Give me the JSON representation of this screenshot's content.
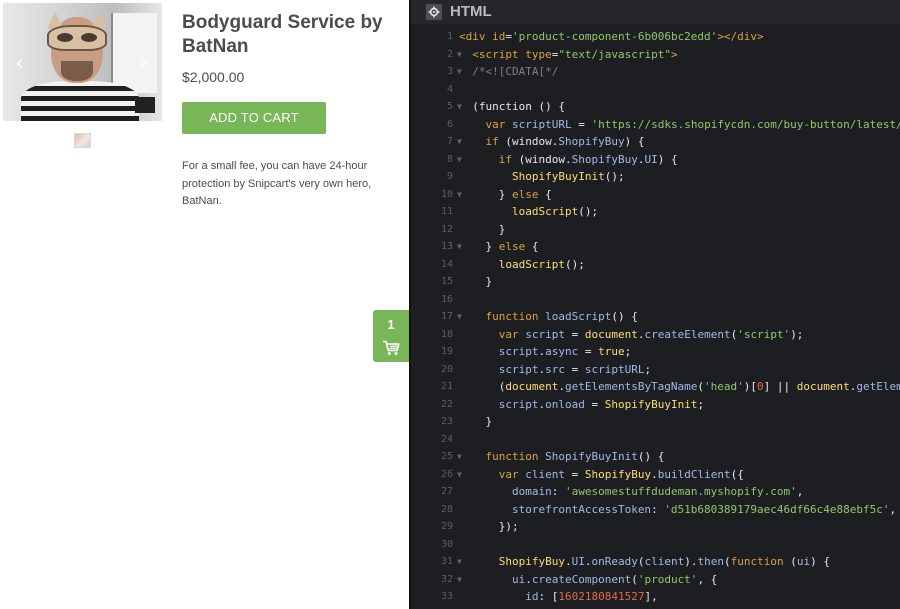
{
  "product": {
    "title": "Bodyguard Service by BatNan",
    "price": "$2,000.00",
    "button_label": "ADD TO CART",
    "description": "For a small fee, you can have 24-hour protection by Snipcart's very own hero, BatNan.",
    "gallery_prev": "‹",
    "gallery_next": "›"
  },
  "cart": {
    "count": "1"
  },
  "editor": {
    "panel_title": "HTML",
    "lines": [
      {
        "n": "1",
        "fold": false,
        "parts": [
          [
            "tag",
            "<div "
          ],
          [
            "attr",
            "id"
          ],
          [
            "plain",
            "="
          ],
          [
            "str",
            "'product-component-6b006bc2edd'"
          ],
          [
            "tag",
            "></div>"
          ]
        ]
      },
      {
        "n": "2",
        "fold": true,
        "parts": [
          [
            "plain",
            "  "
          ],
          [
            "tag",
            "<script "
          ],
          [
            "attr",
            "type"
          ],
          [
            "plain",
            "="
          ],
          [
            "str",
            "\"text/javascript\""
          ],
          [
            "tag",
            ">"
          ]
        ]
      },
      {
        "n": "3",
        "fold": true,
        "parts": [
          [
            "cm",
            "  /*<![CDATA[*/"
          ]
        ]
      },
      {
        "n": "4",
        "fold": false,
        "parts": []
      },
      {
        "n": "5",
        "fold": true,
        "parts": [
          [
            "plain",
            "  (function () {"
          ]
        ]
      },
      {
        "n": "6",
        "fold": false,
        "parts": [
          [
            "plain",
            "    "
          ],
          [
            "kw",
            "var "
          ],
          [
            "prop",
            "scriptURL"
          ],
          [
            "plain",
            " = "
          ],
          [
            "str",
            "'https://sdks.shopifycdn.com/buy-button/latest/"
          ]
        ]
      },
      {
        "n": "7",
        "fold": true,
        "parts": [
          [
            "plain",
            "    "
          ],
          [
            "kw",
            "if "
          ],
          [
            "plain",
            "(window."
          ],
          [
            "prop",
            "ShopifyBuy"
          ],
          [
            "plain",
            ") {"
          ]
        ]
      },
      {
        "n": "8",
        "fold": true,
        "parts": [
          [
            "plain",
            "      "
          ],
          [
            "kw",
            "if "
          ],
          [
            "plain",
            "(window."
          ],
          [
            "prop",
            "ShopifyBuy"
          ],
          [
            "plain",
            "."
          ],
          [
            "prop",
            "UI"
          ],
          [
            "plain",
            ") {"
          ]
        ]
      },
      {
        "n": "9",
        "fold": false,
        "parts": [
          [
            "plain",
            "        "
          ],
          [
            "obj",
            "ShopifyBuyInit"
          ],
          [
            "plain",
            "();"
          ]
        ]
      },
      {
        "n": "10",
        "fold": true,
        "parts": [
          [
            "plain",
            "      } "
          ],
          [
            "kw",
            "else "
          ],
          [
            "plain",
            "{"
          ]
        ]
      },
      {
        "n": "11",
        "fold": false,
        "parts": [
          [
            "plain",
            "        "
          ],
          [
            "obj",
            "loadScript"
          ],
          [
            "plain",
            "();"
          ]
        ]
      },
      {
        "n": "12",
        "fold": false,
        "parts": [
          [
            "plain",
            "      }"
          ]
        ]
      },
      {
        "n": "13",
        "fold": true,
        "parts": [
          [
            "plain",
            "    } "
          ],
          [
            "kw",
            "else "
          ],
          [
            "plain",
            "{"
          ]
        ]
      },
      {
        "n": "14",
        "fold": false,
        "parts": [
          [
            "plain",
            "      "
          ],
          [
            "obj",
            "loadScript"
          ],
          [
            "plain",
            "();"
          ]
        ]
      },
      {
        "n": "15",
        "fold": false,
        "parts": [
          [
            "plain",
            "    }"
          ]
        ]
      },
      {
        "n": "16",
        "fold": false,
        "parts": []
      },
      {
        "n": "17",
        "fold": true,
        "parts": [
          [
            "plain",
            "    "
          ],
          [
            "kw",
            "function "
          ],
          [
            "fnname",
            "loadScript"
          ],
          [
            "plain",
            "() {"
          ]
        ]
      },
      {
        "n": "18",
        "fold": false,
        "parts": [
          [
            "plain",
            "      "
          ],
          [
            "kw",
            "var "
          ],
          [
            "prop",
            "script"
          ],
          [
            "plain",
            " = "
          ],
          [
            "obj",
            "document"
          ],
          [
            "plain",
            "."
          ],
          [
            "prop",
            "createElement"
          ],
          [
            "plain",
            "("
          ],
          [
            "str",
            "'script'"
          ],
          [
            "plain",
            ");"
          ]
        ]
      },
      {
        "n": "19",
        "fold": false,
        "parts": [
          [
            "plain",
            "      "
          ],
          [
            "prop",
            "script"
          ],
          [
            "plain",
            "."
          ],
          [
            "prop",
            "async"
          ],
          [
            "plain",
            " = "
          ],
          [
            "bool",
            "true"
          ],
          [
            "plain",
            ";"
          ]
        ]
      },
      {
        "n": "20",
        "fold": false,
        "parts": [
          [
            "plain",
            "      "
          ],
          [
            "prop",
            "script"
          ],
          [
            "plain",
            "."
          ],
          [
            "prop",
            "src"
          ],
          [
            "plain",
            " = "
          ],
          [
            "prop",
            "scriptURL"
          ],
          [
            "plain",
            ";"
          ]
        ]
      },
      {
        "n": "21",
        "fold": false,
        "parts": [
          [
            "plain",
            "      ("
          ],
          [
            "obj",
            "document"
          ],
          [
            "plain",
            "."
          ],
          [
            "prop",
            "getElementsByTagName"
          ],
          [
            "plain",
            "("
          ],
          [
            "str",
            "'head'"
          ],
          [
            "plain",
            ")["
          ],
          [
            "num",
            "0"
          ],
          [
            "plain",
            "] || "
          ],
          [
            "obj",
            "document"
          ],
          [
            "plain",
            "."
          ],
          [
            "prop",
            "getElem"
          ]
        ]
      },
      {
        "n": "22",
        "fold": false,
        "parts": [
          [
            "plain",
            "      "
          ],
          [
            "prop",
            "script"
          ],
          [
            "plain",
            "."
          ],
          [
            "prop",
            "onload"
          ],
          [
            "plain",
            " = "
          ],
          [
            "obj",
            "ShopifyBuyInit"
          ],
          [
            "plain",
            ";"
          ]
        ]
      },
      {
        "n": "23",
        "fold": false,
        "parts": [
          [
            "plain",
            "    }"
          ]
        ]
      },
      {
        "n": "24",
        "fold": false,
        "parts": []
      },
      {
        "n": "25",
        "fold": true,
        "parts": [
          [
            "plain",
            "    "
          ],
          [
            "kw",
            "function "
          ],
          [
            "fnname",
            "ShopifyBuyInit"
          ],
          [
            "plain",
            "() {"
          ]
        ]
      },
      {
        "n": "26",
        "fold": true,
        "parts": [
          [
            "plain",
            "      "
          ],
          [
            "kw",
            "var "
          ],
          [
            "prop",
            "client"
          ],
          [
            "plain",
            " = "
          ],
          [
            "obj",
            "ShopifyBuy"
          ],
          [
            "plain",
            "."
          ],
          [
            "prop",
            "buildClient"
          ],
          [
            "plain",
            "({"
          ]
        ]
      },
      {
        "n": "27",
        "fold": false,
        "parts": [
          [
            "plain",
            "        "
          ],
          [
            "prop",
            "domain"
          ],
          [
            "plain",
            ": "
          ],
          [
            "str",
            "'awesomestuffdudeman.myshopify.com'"
          ],
          [
            "plain",
            ","
          ]
        ]
      },
      {
        "n": "28",
        "fold": false,
        "parts": [
          [
            "plain",
            "        "
          ],
          [
            "prop",
            "storefrontAccessToken"
          ],
          [
            "plain",
            ": "
          ],
          [
            "str",
            "'d51b680389179aec46df66c4e88ebf5c'"
          ],
          [
            "plain",
            ","
          ]
        ]
      },
      {
        "n": "29",
        "fold": false,
        "parts": [
          [
            "plain",
            "      });"
          ]
        ]
      },
      {
        "n": "30",
        "fold": false,
        "parts": []
      },
      {
        "n": "31",
        "fold": true,
        "parts": [
          [
            "plain",
            "      "
          ],
          [
            "obj",
            "ShopifyBuy"
          ],
          [
            "plain",
            "."
          ],
          [
            "prop",
            "UI"
          ],
          [
            "plain",
            "."
          ],
          [
            "prop",
            "onReady"
          ],
          [
            "plain",
            "("
          ],
          [
            "prop",
            "client"
          ],
          [
            "plain",
            ")."
          ],
          [
            "prop",
            "then"
          ],
          [
            "plain",
            "("
          ],
          [
            "kw",
            "function "
          ],
          [
            "plain",
            "("
          ],
          [
            "prop",
            "ui"
          ],
          [
            "plain",
            ") {"
          ]
        ]
      },
      {
        "n": "32",
        "fold": true,
        "parts": [
          [
            "plain",
            "        "
          ],
          [
            "prop",
            "ui"
          ],
          [
            "plain",
            "."
          ],
          [
            "prop",
            "createComponent"
          ],
          [
            "plain",
            "("
          ],
          [
            "str",
            "'product'"
          ],
          [
            "plain",
            ", {"
          ]
        ]
      },
      {
        "n": "33",
        "fold": false,
        "parts": [
          [
            "plain",
            "          "
          ],
          [
            "prop",
            "id"
          ],
          [
            "plain",
            ": ["
          ],
          [
            "num",
            "1602180841527"
          ],
          [
            "plain",
            "],"
          ]
        ]
      }
    ]
  },
  "colors": {
    "accent_green": "#78b657",
    "editor_bg": "#1d1e22",
    "text_dark": "#4c4c4c"
  }
}
